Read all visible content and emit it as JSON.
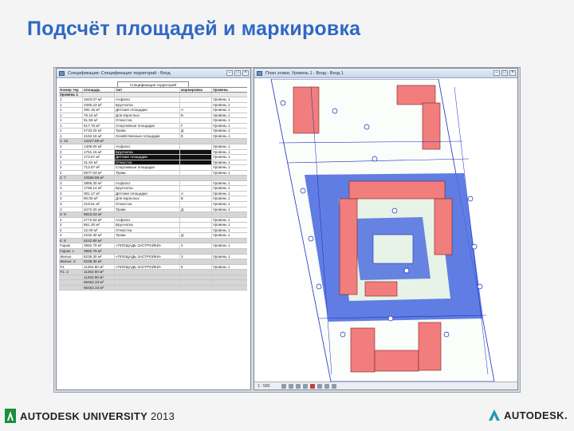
{
  "slide": {
    "title": "Подсчёт площадей и маркировка"
  },
  "left_window": {
    "title": "Спецификация: Спецификация территорий - Вход",
    "sheet_name": "Спецификация территорий",
    "headers": [
      "Номер тер",
      "площадь",
      "тип",
      "маркировка",
      "Уровень"
    ],
    "rows": [
      {
        "kind": "group",
        "cells": [
          "Уровень 1",
          "",
          "",
          "",
          ""
        ]
      },
      {
        "kind": "data",
        "cells": [
          "1",
          "1623.07 м²",
          "Асфальт",
          "",
          "Уровень 1"
        ]
      },
      {
        "kind": "data",
        "cells": [
          "1",
          "2365.23 м²",
          "Брусчатка",
          "",
          "Уровень 1"
        ]
      },
      {
        "kind": "data",
        "cells": [
          "1",
          "392.15 м²",
          "Детские площадки",
          "А",
          "Уровень 1"
        ]
      },
      {
        "kind": "data",
        "cells": [
          "1",
          "76.24 м²",
          "Для взрослых",
          "Б",
          "Уровень 1"
        ]
      },
      {
        "kind": "data",
        "cells": [
          "1",
          "51.55 м²",
          "Отмостка",
          "",
          "Уровень 1"
        ]
      },
      {
        "kind": "data",
        "cells": [
          "1",
          "617.75 м²",
          "Спортивные площадки",
          "Г",
          "Уровень 1"
        ]
      },
      {
        "kind": "data",
        "cells": [
          "1",
          "4733.20 м²",
          "Трава",
          "Д",
          "Уровень 1"
        ]
      },
      {
        "kind": "data",
        "cells": [
          "1",
          "4163.16 м²",
          "Хозяйственные площадки",
          "Е",
          "Уровень 1"
        ]
      },
      {
        "kind": "total",
        "cells": [
          "1: 10",
          "13427.89 м²",
          "",
          "",
          ""
        ]
      },
      {
        "kind": "data",
        "cells": [
          "2",
          "1309.00 м²",
          "Асфальт",
          "",
          "Уровень 1"
        ]
      },
      {
        "kind": "sel",
        "cells": [
          "2",
          "1761.15 м²",
          "Брусчатка",
          "",
          "Уровень 1"
        ]
      },
      {
        "kind": "sel",
        "cells": [
          "2",
          "173.57 м²",
          "Детские площадки",
          "А",
          "Уровень 1"
        ]
      },
      {
        "kind": "sel",
        "cells": [
          "2",
          "31.62 м²",
          "Отмостка",
          "",
          "Уровень 1"
        ]
      },
      {
        "kind": "data",
        "cells": [
          "2",
          "713.57 м²",
          "Спортивные площадки",
          "",
          "Уровень 1"
        ]
      },
      {
        "kind": "data",
        "cells": [
          "2",
          "5977.03 м²",
          "Трава",
          "",
          "Уровень 1"
        ]
      },
      {
        "kind": "total",
        "cells": [
          "2: 7",
          "10588.96 м²",
          "",
          "",
          ""
        ]
      },
      {
        "kind": "data",
        "cells": [
          "3",
          "3955.30 м²",
          "Асфальт",
          "",
          "Уровень 1"
        ]
      },
      {
        "kind": "data",
        "cells": [
          "3",
          "1758.14 м²",
          "Брусчатка",
          "",
          "Уровень 1"
        ]
      },
      {
        "kind": "data",
        "cells": [
          "3",
          "391.17 м²",
          "Детские площадки",
          "А",
          "Уровень 1"
        ]
      },
      {
        "kind": "data",
        "cells": [
          "3",
          "90.05 м²",
          "Для взрослых",
          "Б",
          "Уровень 1"
        ]
      },
      {
        "kind": "data",
        "cells": [
          "3",
          "219.51 м²",
          "Отмостка",
          "",
          "Уровень 1"
        ]
      },
      {
        "kind": "data",
        "cells": [
          "3",
          "3472.00 м²",
          "Трава",
          "Д",
          "Уровень 1"
        ]
      },
      {
        "kind": "total",
        "cells": [
          "3: 9",
          "9823.03 м²",
          "",
          "",
          ""
        ]
      },
      {
        "kind": "data",
        "cells": [
          "4",
          "2772.54 м²",
          "Асфальт",
          "",
          "Уровень 1"
        ]
      },
      {
        "kind": "data",
        "cells": [
          "4",
          "861.30 м²",
          "Брусчатка",
          "",
          "Уровень 1"
        ]
      },
      {
        "kind": "data",
        "cells": [
          "4",
          "12.00 м²",
          "Отмостка",
          "",
          "Уровень 1"
        ]
      },
      {
        "kind": "data",
        "cells": [
          "4",
          "2232.30 м²",
          "Трава",
          "Д",
          "Уровень 1"
        ]
      },
      {
        "kind": "total",
        "cells": [
          "4: 6",
          "6242.80 м²",
          "",
          "",
          ""
        ]
      },
      {
        "kind": "data",
        "cells": [
          "Гараж",
          "3992.79 м²",
          "«ПЛОЩАДЬ ЗАСТРОЙКИ»",
          "4",
          "Уровень 1"
        ]
      },
      {
        "kind": "total",
        "cells": [
          "Гараж: 1",
          "3992.79 м²",
          "",
          "",
          ""
        ]
      },
      {
        "kind": "data",
        "cells": [
          "Жилье",
          "8239.30 м²",
          "«ПЛОЩАДЬ ЗАСТРОЙКИ»",
          "3",
          "Уровень 1"
        ]
      },
      {
        "kind": "total",
        "cells": [
          "Жилье: 3",
          "8239.30 м²",
          "",
          "",
          ""
        ]
      },
      {
        "kind": "data",
        "cells": [
          "П1",
          "11254.90 м²",
          "«ПЛОЩАДЬ ЗАСТРОЙКИ»",
          "5",
          "Уровень 1"
        ]
      },
      {
        "kind": "total",
        "cells": [
          "П1: 2",
          "11254.90 м²",
          "",
          "",
          ""
        ]
      },
      {
        "kind": "total",
        "cells": [
          "",
          "11254.90 м²",
          "",
          "",
          ""
        ]
      },
      {
        "kind": "total",
        "cells": [
          "",
          "66452.33 м²",
          "",
          "",
          ""
        ]
      },
      {
        "kind": "total",
        "cells": [
          "",
          "66452.33 м²",
          "",
          "",
          ""
        ]
      }
    ]
  },
  "right_window": {
    "title": "План этажа: Уровень 1 - Вход - Вход 1",
    "scale": "1 : 500",
    "colors": {
      "building": "#f27d7d",
      "paving": "#4f6fe0",
      "lines": "#1b2bbf",
      "grass": "#e7f3e7"
    }
  },
  "footer": {
    "au_brand": "AUTODESK",
    "au_event": "UNIVERSITY",
    "au_year": "2013",
    "brand": "AUTODESK."
  }
}
